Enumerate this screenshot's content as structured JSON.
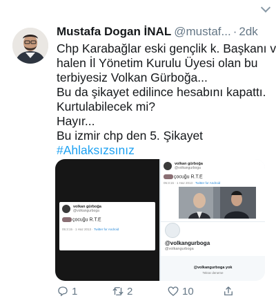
{
  "author": {
    "name": "Mustafa Dogan İNAL",
    "handle": "@mustaf...",
    "separator": "·",
    "time": "2dk"
  },
  "tweet": {
    "lines": [
      "Chp Karabağlar eski gençlik k. Başkanı ve",
      "halen İl Yönetim Kurulu Üyesi olan bu",
      "terbiyesiz Volkan Gürboğa...",
      "Bu da şikayet edilince hesabını kapattı.",
      "Kurtulabilecek mi?",
      "Hayır...",
      "Bu izmir chp den 5. Şikayet"
    ],
    "hashtag": "#Ahlaksızsınız"
  },
  "media": {
    "left_card": {
      "name": "volkan gürboğa",
      "handle": "@volkangurboga",
      "text": "çocuğu R.T.E",
      "meta_time": "05:3:15 · 1 Haz 2013 ·",
      "meta_source": "Twitter for Android"
    },
    "right_card": {
      "name": "volkan gürboğa",
      "handle": "@volkangurboga",
      "text": "çocuğu R.T.E",
      "meta_time": "05:3:15 · 1 Haz 2013 ·",
      "meta_source": "Twitter for Android",
      "profile_handle_bold": "@volkangurboga",
      "profile_handle": "@volkangurboga",
      "missing_text": "@volkangurboga yok",
      "retry_text": "Tekrar deneme"
    }
  },
  "actions": {
    "reply_count": "1",
    "retweet_count": "2",
    "like_count": "10"
  },
  "colors": {
    "accent": "#1da1f2",
    "secondary_text": "#657786"
  }
}
